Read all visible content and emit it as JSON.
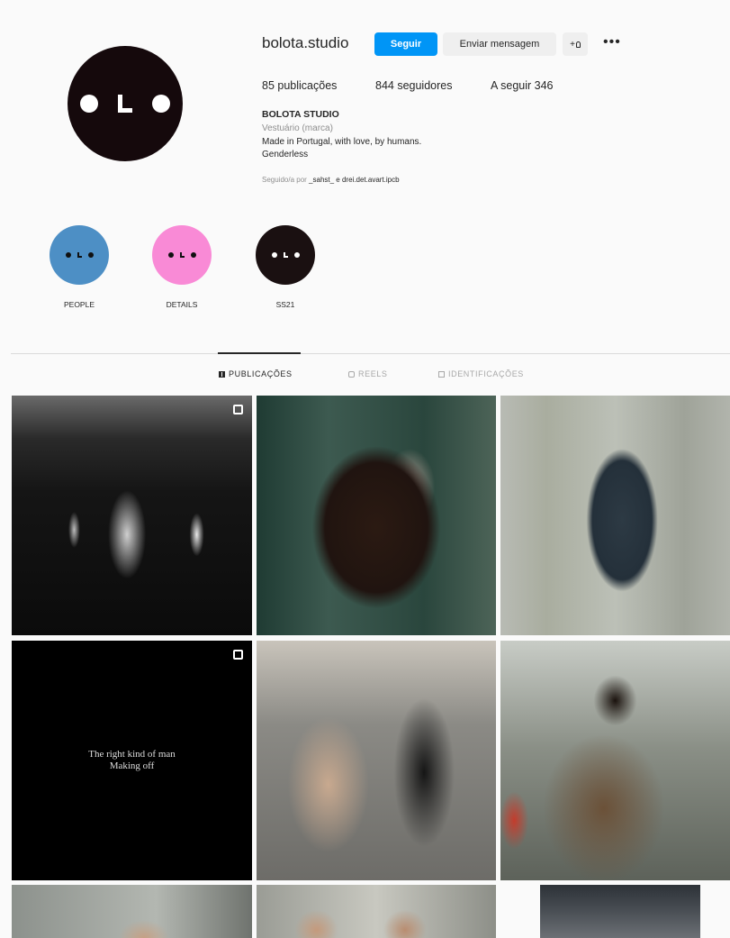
{
  "profile": {
    "username": "bolota.studio",
    "buttons": {
      "follow": "Seguir",
      "message": "Enviar mensagem",
      "suggest": "+ያ",
      "more": "•••"
    },
    "stats": {
      "posts": "85 publicações",
      "followers": "844 seguidores",
      "following": "A seguir 346"
    },
    "bio": {
      "name": "BOLOTA STUDIO",
      "category": "Vestuário (marca)",
      "line1": "Made in Portugal, with love, by humans.",
      "line2": "Genderless"
    },
    "followed_by": {
      "prefix": "Seguido/a por ",
      "names": "_sahst_ e drei.det.avart.ipcb"
    }
  },
  "highlights": [
    {
      "label": "PEOPLE",
      "color": "#4d8fc5"
    },
    {
      "label": "DETAILS",
      "color": "#f98ad6"
    },
    {
      "label": "SS21",
      "color": "#1a1011"
    }
  ],
  "tabs": [
    {
      "label": "PUBLICAÇÕES",
      "icon": "grid-icon",
      "active": true
    },
    {
      "label": "REELS",
      "icon": "reels-icon",
      "active": false
    },
    {
      "label": "IDENTIFICAÇÕES",
      "icon": "tag-icon",
      "active": false
    }
  ],
  "posts": [
    {
      "name": "post-corridor",
      "badge": "carousel-icon"
    },
    {
      "name": "post-portrait-nails",
      "badge": ""
    },
    {
      "name": "post-sequin-top",
      "badge": ""
    },
    {
      "name": "post-text-video",
      "badge": "reel-icon",
      "text_line1": "The right kind of man",
      "text_line2": "Making off"
    },
    {
      "name": "post-backstage-1",
      "badge": ""
    },
    {
      "name": "post-backstage-2",
      "badge": ""
    },
    {
      "name": "post-row3-1",
      "badge": ""
    },
    {
      "name": "post-row3-2",
      "badge": ""
    },
    {
      "name": "post-row3-3",
      "badge": ""
    }
  ],
  "colors": {
    "accent": "#0095f6",
    "text": "#262626",
    "muted": "#8e8e8e"
  }
}
